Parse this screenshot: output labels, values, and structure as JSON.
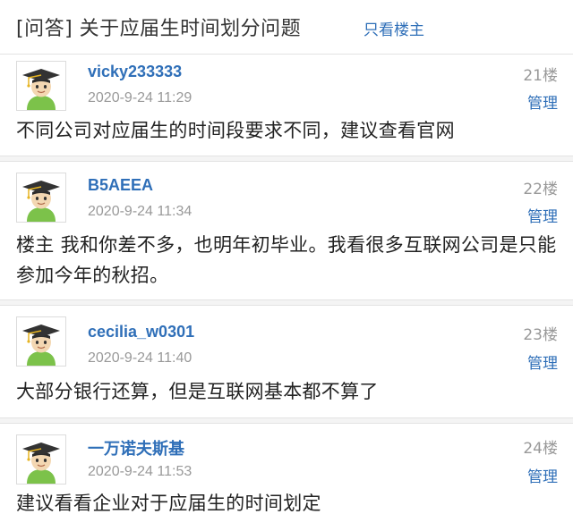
{
  "thread": {
    "title": "[问答] 关于应届生时间划分问题",
    "only_op_label": "只看楼主"
  },
  "posts": [
    {
      "username": "vicky233333",
      "time": "2020-9-24 11:29",
      "floor": "21楼",
      "manage_label": "管理",
      "content": "不同公司对应届生的时间段要求不同，建议查看官网"
    },
    {
      "username": "B5AEEA",
      "time": "2020-9-24 11:34",
      "floor": "22楼",
      "manage_label": "管理",
      "content": "楼主 我和你差不多，也明年初毕业。我看很多互联网公司是只能参加今年的秋招。"
    },
    {
      "username": "cecilia_w0301",
      "time": "2020-9-24 11:40",
      "floor": "23楼",
      "manage_label": "管理",
      "content": "大部分银行还算，但是互联网基本都不算了"
    },
    {
      "username": "一万诺夫斯基",
      "time": "2020-9-24 11:53",
      "floor": "24楼",
      "manage_label": "管理",
      "content": "建议看看企业对于应届生的时间划定"
    }
  ],
  "icons": {
    "avatar": "graduate-avatar-icon"
  },
  "colors": {
    "link": "#2f6fb8",
    "meta": "#999999",
    "text": "#222222",
    "separator": "#e3e3e3"
  }
}
